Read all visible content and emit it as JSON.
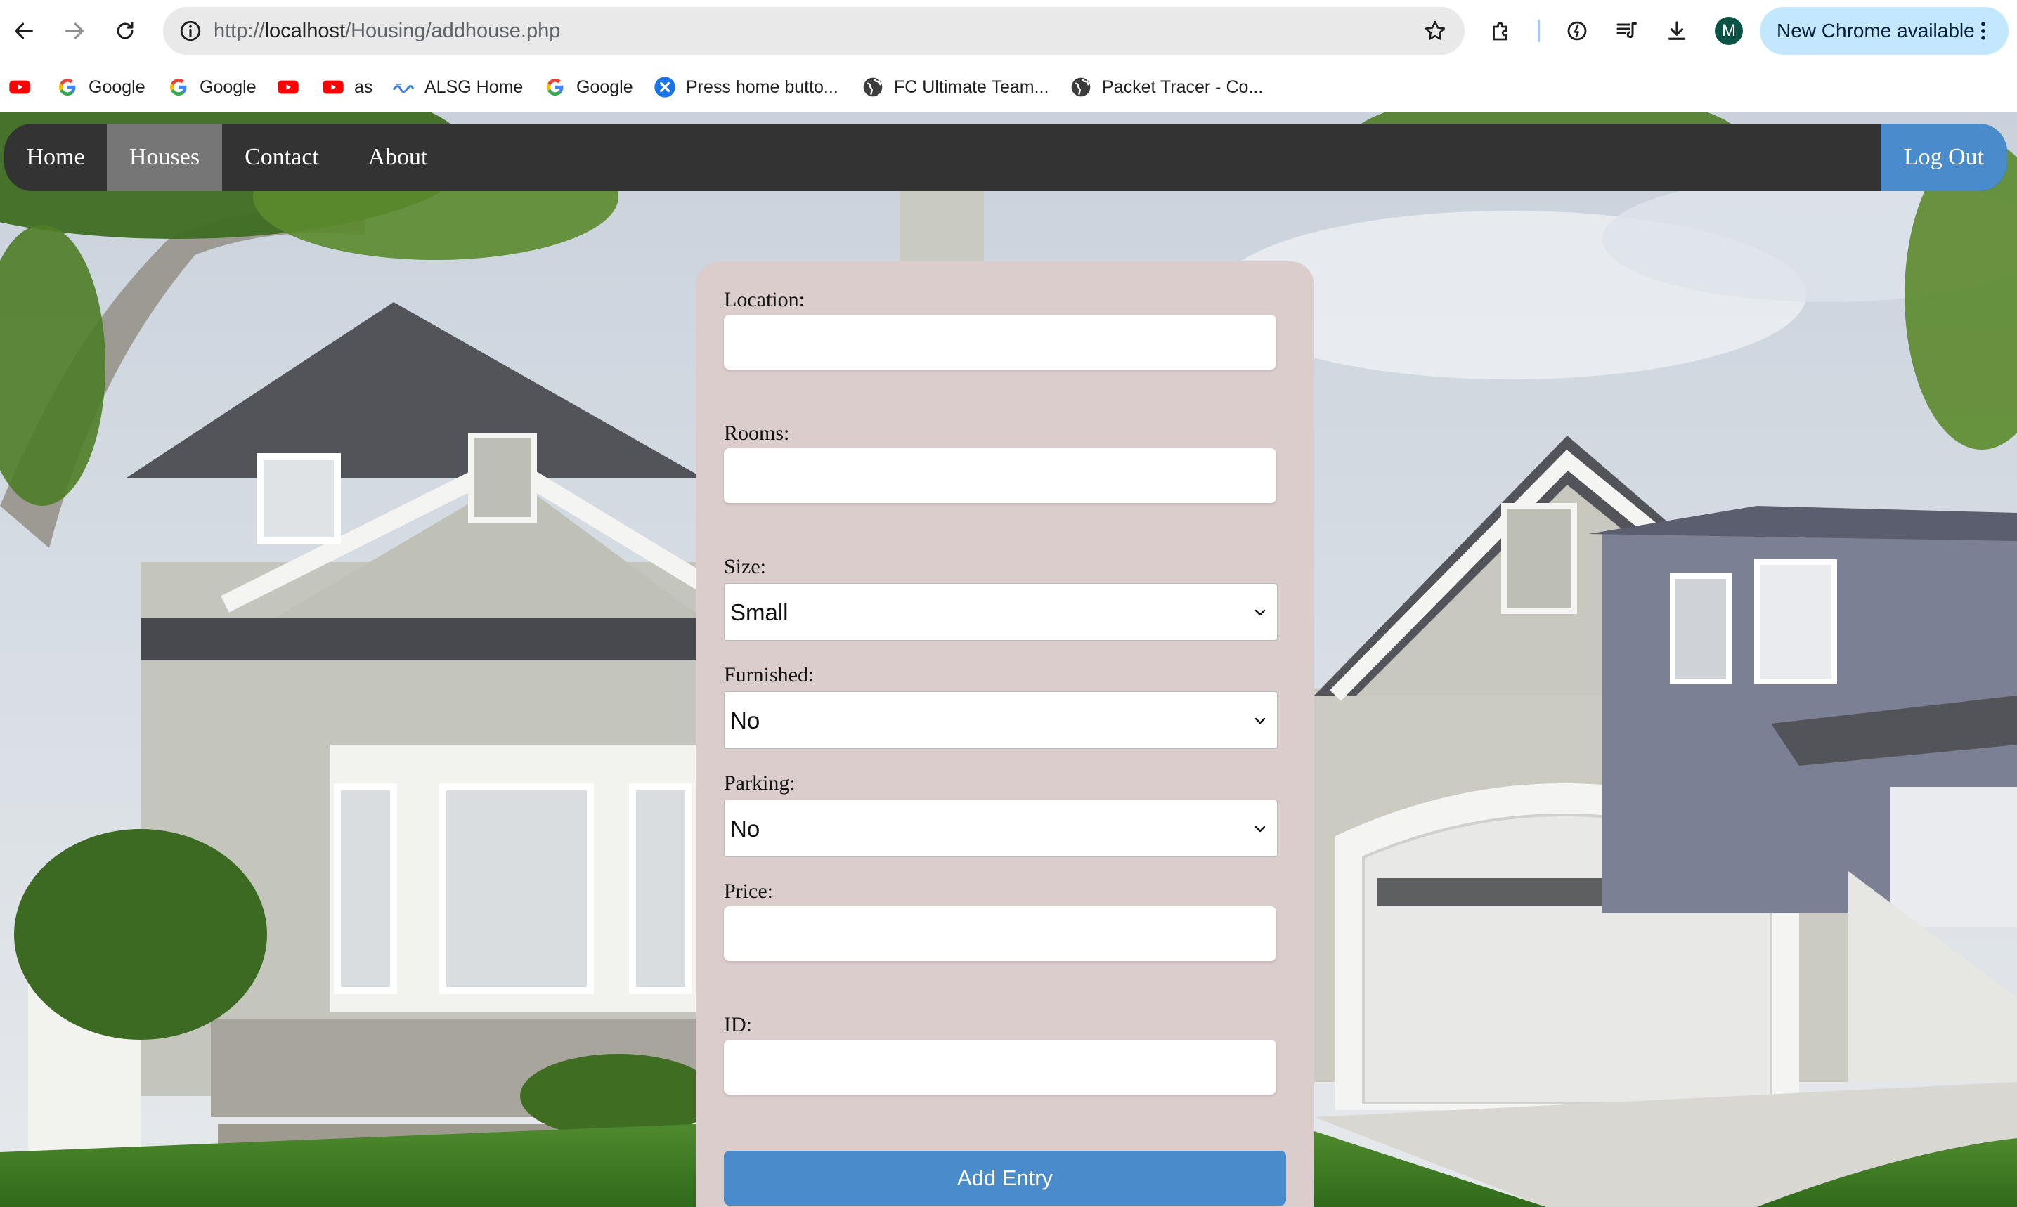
{
  "browser": {
    "url_prefix": "http://",
    "url_host": "localhost",
    "url_path": "/Housing/addhouse.php",
    "profile_initial": "M",
    "update_label": "New Chrome available"
  },
  "bookmarks": [
    {
      "label": "",
      "icon": "youtube-icon"
    },
    {
      "label": "Google",
      "icon": "google-icon"
    },
    {
      "label": "Google",
      "icon": "google-icon"
    },
    {
      "label": "",
      "icon": "youtube-icon"
    },
    {
      "label": "as",
      "icon": "youtube-icon"
    },
    {
      "label": "ALSG Home",
      "icon": "alsg-icon"
    },
    {
      "label": "Google",
      "icon": "google-icon"
    },
    {
      "label": "Press home butto...",
      "icon": "x-circle-icon"
    },
    {
      "label": "FC Ultimate Team...",
      "icon": "globe-icon"
    },
    {
      "label": "Packet Tracer - Co...",
      "icon": "globe-icon"
    }
  ],
  "nav": {
    "items": [
      {
        "label": "Home"
      },
      {
        "label": "Houses"
      },
      {
        "label": "Contact"
      },
      {
        "label": "About"
      }
    ],
    "active": "Houses",
    "logout_label": "Log Out"
  },
  "form": {
    "location_label": "Location:",
    "location_value": "",
    "rooms_label": "Rooms:",
    "rooms_value": "",
    "size_label": "Size:",
    "size_value": "Small",
    "furnished_label": "Furnished:",
    "furnished_value": "No",
    "parking_label": "Parking:",
    "parking_value": "No",
    "price_label": "Price:",
    "price_value": "",
    "id_label": "ID:",
    "id_value": "",
    "submit_label": "Add Entry"
  },
  "colors": {
    "nav_bg": "#333333",
    "nav_active": "#767676",
    "accent_blue": "#4a8ccb",
    "form_bg": "#dccdcd"
  }
}
